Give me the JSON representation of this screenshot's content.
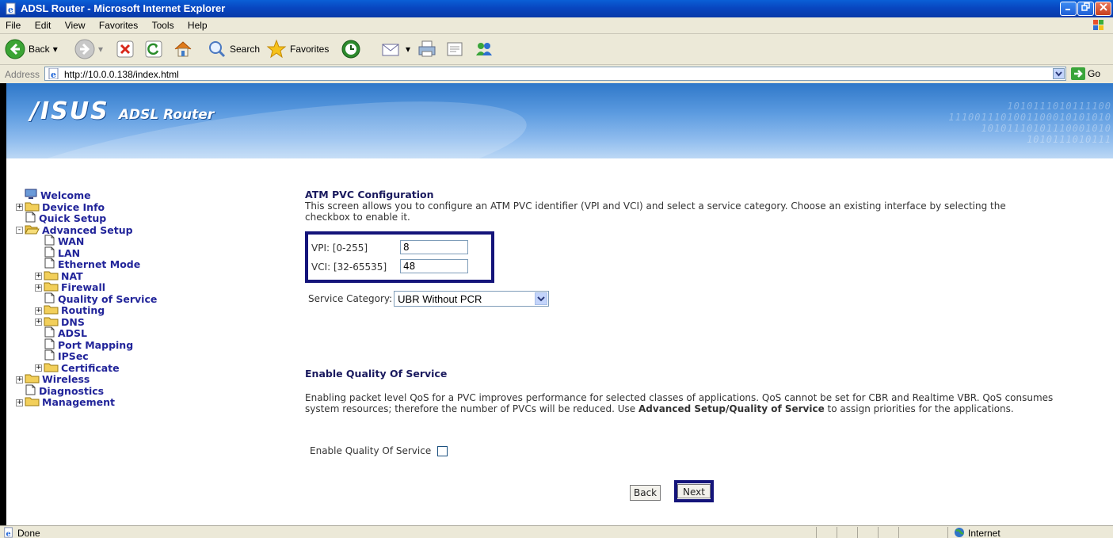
{
  "window": {
    "title": "ADSL Router - Microsoft Internet Explorer"
  },
  "menu": [
    "File",
    "Edit",
    "View",
    "Favorites",
    "Tools",
    "Help"
  ],
  "toolbar": {
    "back_label": "Back",
    "search_label": "Search",
    "favorites_label": "Favorites"
  },
  "address": {
    "label": "Address",
    "url": "http://10.0.0.138/index.html",
    "go_label": "Go"
  },
  "banner": {
    "brand": "/ISUS",
    "subtitle": "ADSL Router",
    "binary": [
      "1010111010111100",
      "1110011101001100010101010",
      "10101110101110001010",
      "1010111010111"
    ]
  },
  "nav": {
    "items": [
      {
        "label": "Welcome",
        "icon": "computer-icon",
        "expander": "none",
        "indent": 0
      },
      {
        "label": "Device Info",
        "icon": "folder-icon",
        "expander": "+",
        "indent": 0
      },
      {
        "label": "Quick Setup",
        "icon": "page-icon",
        "expander": "none",
        "indent": 0
      },
      {
        "label": "Advanced Setup",
        "icon": "folder-open-icon",
        "expander": "-",
        "indent": 0
      },
      {
        "label": "WAN",
        "icon": "page-icon",
        "expander": "none",
        "indent": 1
      },
      {
        "label": "LAN",
        "icon": "page-icon",
        "expander": "none",
        "indent": 1
      },
      {
        "label": "Ethernet Mode",
        "icon": "page-icon",
        "expander": "none",
        "indent": 1
      },
      {
        "label": "NAT",
        "icon": "folder-icon",
        "expander": "+",
        "indent": 1
      },
      {
        "label": "Firewall",
        "icon": "folder-icon",
        "expander": "+",
        "indent": 1
      },
      {
        "label": "Quality of Service",
        "icon": "page-icon",
        "expander": "none",
        "indent": 1
      },
      {
        "label": "Routing",
        "icon": "folder-icon",
        "expander": "+",
        "indent": 1
      },
      {
        "label": "DNS",
        "icon": "folder-icon",
        "expander": "+",
        "indent": 1
      },
      {
        "label": "ADSL",
        "icon": "page-icon",
        "expander": "none",
        "indent": 1
      },
      {
        "label": "Port Mapping",
        "icon": "page-icon",
        "expander": "none",
        "indent": 1
      },
      {
        "label": "IPSec",
        "icon": "page-icon",
        "expander": "none",
        "indent": 1
      },
      {
        "label": "Certificate",
        "icon": "folder-icon",
        "expander": "+",
        "indent": 1
      },
      {
        "label": "Wireless",
        "icon": "folder-icon",
        "expander": "+",
        "indent": 0
      },
      {
        "label": "Diagnostics",
        "icon": "page-icon",
        "expander": "none",
        "indent": 0
      },
      {
        "label": "Management",
        "icon": "folder-icon",
        "expander": "+",
        "indent": 0
      }
    ]
  },
  "atm": {
    "title": "ATM PVC Configuration",
    "description": "This screen allows you to configure an ATM PVC identifier (VPI and VCI) and select a service category. Choose an existing interface by selecting the checkbox to enable it.",
    "vpi_label": "VPI: [0-255]",
    "vpi_value": "8",
    "vci_label": "VCI: [32-65535]",
    "vci_value": "48",
    "service_label": "Service Category:",
    "service_value": "UBR Without PCR"
  },
  "qos": {
    "title": "Enable Quality Of Service",
    "para_part1": "Enabling packet level QoS for a PVC improves performance for selected classes of applications.  QoS cannot be set for CBR and Realtime VBR.  QoS consumes system resources; therefore the number of PVCs will be reduced. Use ",
    "para_bold": "Advanced Setup/Quality of Service",
    "para_part2": " to assign priorities for the applications.",
    "checkbox_label": "Enable Quality Of Service",
    "checked": false
  },
  "buttons": {
    "back": "Back",
    "next": "Next"
  },
  "status": {
    "text": "Done",
    "zone": "Internet"
  },
  "colors": {
    "highlight_border": "#14147a",
    "nav_text": "#22259a",
    "titlebar": "#0846c0"
  }
}
